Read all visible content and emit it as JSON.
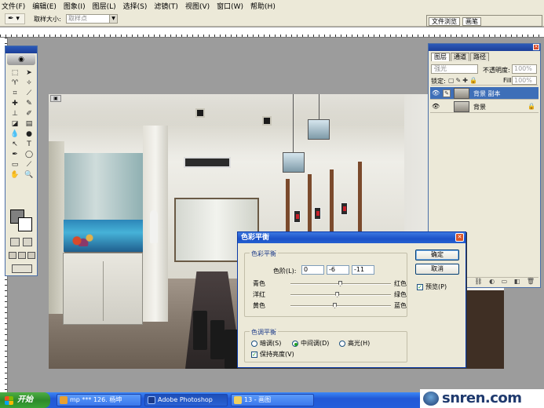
{
  "menu": {
    "items": [
      "文件(F)",
      "编辑(E)",
      "图象(I)",
      "图层(L)",
      "选择(S)",
      "滤镜(T)",
      "视图(V)",
      "窗口(W)",
      "帮助(H)"
    ]
  },
  "options_bar": {
    "tool_glyph": "✒ ▾",
    "sample_size_label": "取样大小:",
    "sample_size_value": "取样点"
  },
  "palette_well": {
    "tabs": [
      "文件浏览",
      "画笔"
    ]
  },
  "layers_palette": {
    "tabs": [
      "图层",
      "通道",
      "路径"
    ],
    "blend_mode": "强光",
    "opacity_label": "不透明度:",
    "opacity_value": "100%",
    "lock_label": "锁定:",
    "fill_label": "Fill:",
    "fill_value": "100%",
    "layers": [
      {
        "name": "背景 副本",
        "selected": true
      },
      {
        "name": "背景",
        "selected": false
      }
    ]
  },
  "dialog": {
    "title": "色彩平衡",
    "color_balance_group": "色彩平衡",
    "levels_label": "色阶(L):",
    "levels": [
      "0",
      "-6",
      "-11"
    ],
    "sliders": [
      {
        "left": "青色",
        "right": "红色",
        "value": 0
      },
      {
        "left": "洋红",
        "right": "绿色",
        "value": -6
      },
      {
        "left": "黄色",
        "right": "蓝色",
        "value": -11
      }
    ],
    "tone_group": "色调平衡",
    "tones": [
      {
        "label": "暗调(S)",
        "checked": false
      },
      {
        "label": "中间调(D)",
        "checked": true
      },
      {
        "label": "高光(H)",
        "checked": false
      }
    ],
    "preserve_luminosity": "保持亮度(V)",
    "ok": "确定",
    "cancel": "取消",
    "preview": "预览(P)"
  },
  "taskbar": {
    "start": "开始",
    "tasks": [
      {
        "label": "mp *** 126. 杨坤",
        "active": false
      },
      {
        "label": "Adobe Photoshop",
        "active": true
      },
      {
        "label": "13 - 画图",
        "active": false
      }
    ],
    "brand": "snren.com"
  }
}
